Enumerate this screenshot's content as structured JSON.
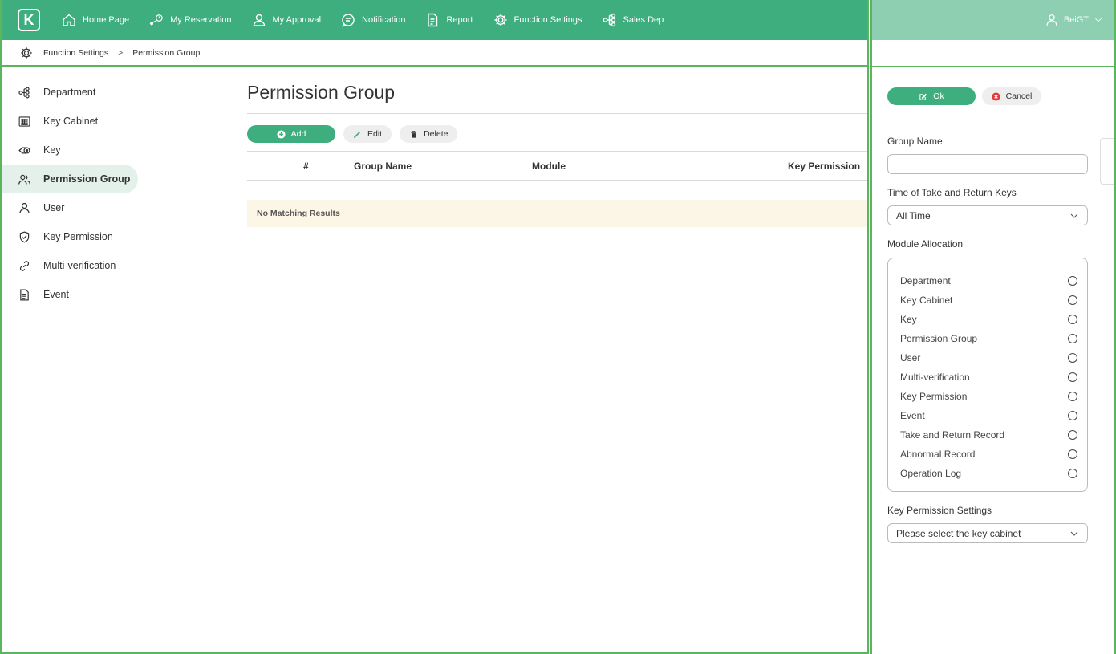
{
  "topbar": {
    "logo_text": "K",
    "nav": [
      {
        "label": "Home Page",
        "icon": "home-icon"
      },
      {
        "label": "My Reservation",
        "icon": "key-clock-icon"
      },
      {
        "label": "My Approval",
        "icon": "user-check-icon"
      },
      {
        "label": "Notification",
        "icon": "message-icon"
      },
      {
        "label": "Report",
        "icon": "document-icon"
      },
      {
        "label": "Function Settings",
        "icon": "gear-icon"
      },
      {
        "label": "Sales Dep",
        "icon": "org-chart-icon"
      }
    ],
    "user": "BeiGT"
  },
  "breadcrumb": {
    "parent": "Function Settings",
    "separator": ">",
    "current": "Permission Group"
  },
  "sidebar": {
    "items": [
      {
        "label": "Department",
        "icon": "org-chart-icon"
      },
      {
        "label": "Key Cabinet",
        "icon": "cabinet-icon"
      },
      {
        "label": "Key",
        "icon": "key-icon"
      },
      {
        "label": "Permission Group",
        "icon": "users-icon",
        "active": true
      },
      {
        "label": "User",
        "icon": "user-icon"
      },
      {
        "label": "Key Permission",
        "icon": "shield-check-icon"
      },
      {
        "label": "Multi-verification",
        "icon": "link-icon"
      },
      {
        "label": "Event",
        "icon": "document-icon"
      }
    ]
  },
  "main": {
    "title": "Permission Group",
    "toolbar": {
      "add": "Add",
      "edit": "Edit",
      "delete": "Delete"
    },
    "columns": [
      "#",
      "Group Name",
      "Module",
      "Key Permission"
    ],
    "empty_text": "No Matching Results"
  },
  "panel": {
    "ok": "Ok",
    "cancel": "Cancel",
    "group_name_label": "Group Name",
    "group_name_value": "",
    "time_label": "Time of Take and Return Keys",
    "time_value": "All Time",
    "module_label": "Module Allocation",
    "modules": [
      "Department",
      "Key Cabinet",
      "Key",
      "Permission Group",
      "User",
      "Multi-verification",
      "Key Permission",
      "Event",
      "Take and Return Record",
      "Abnormal Record",
      "Operation Log"
    ],
    "key_permission_label": "Key Permission Settings",
    "key_permission_placeholder": "Please select the key cabinet"
  },
  "colors": {
    "primary": "#3fae7f",
    "frame": "#5bb55d",
    "header_right": "#8dcfb0",
    "active_bg": "#e3f1ea",
    "empty_bg": "#fbf6e6",
    "cancel_red": "#e53935"
  }
}
